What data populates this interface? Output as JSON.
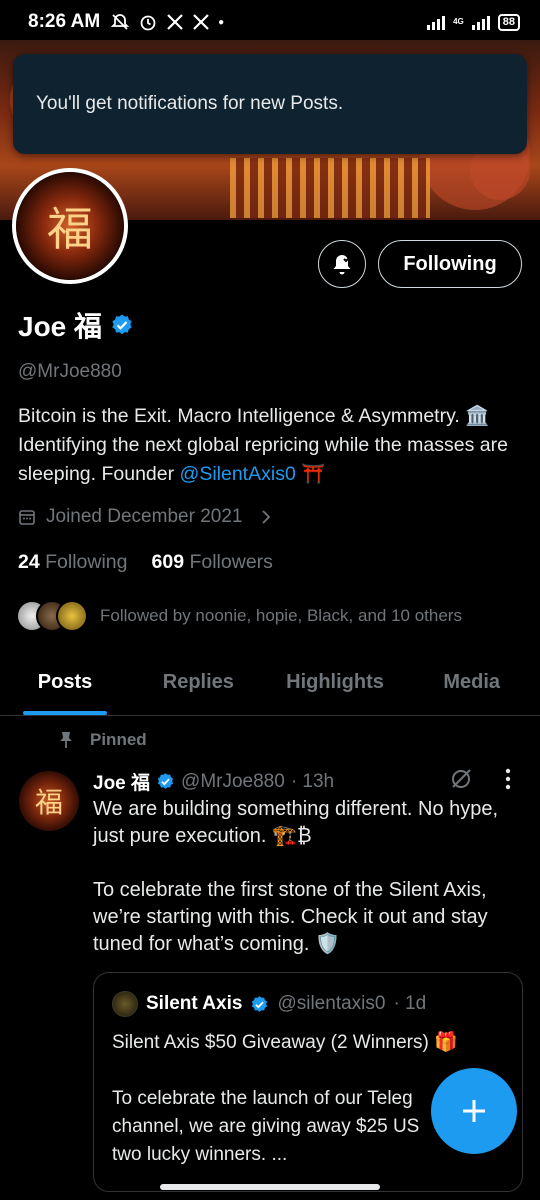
{
  "status_bar": {
    "time": "8:26 AM",
    "network": "4G",
    "battery": "88"
  },
  "toast": {
    "message": "You'll get notifications for new Posts."
  },
  "profile": {
    "avatar_glyph": "福",
    "display_name": "Joe 福",
    "handle": "@MrJoe880",
    "bio_main": "Bitcoin is the Exit. Macro Intelligence & Asymmetry. 🏛️  Identifying the next global repricing while the masses are sleeping.   Founder ",
    "bio_link": "@SilentAxis0",
    "bio_end": " ⛩️",
    "joined": "Joined December 2021",
    "following_count": "24",
    "following_label": "Following",
    "followers_count": "609",
    "followers_label": "Followers",
    "followed_by": "Followed by noonie, hopie, Black, and 10 others",
    "following_button": "Following"
  },
  "tabs": [
    {
      "label": "Posts",
      "active": true
    },
    {
      "label": "Replies",
      "active": false
    },
    {
      "label": "Highlights",
      "active": false
    },
    {
      "label": "Media",
      "active": false
    }
  ],
  "post": {
    "pinned_label": "Pinned",
    "avatar_glyph": "福",
    "name": "Joe 福",
    "handle": "@MrJoe880",
    "time": "· 13h",
    "text": "We are building something different. No hype, just pure execution. 🏗️₿\n\nTo celebrate the first stone of the Silent Axis, we’re starting with this. Check it out and stay tuned for what’s coming. 🛡️",
    "quote": {
      "name": "Silent Axis",
      "handle": "@silentaxis0",
      "time": "· 1d",
      "text": "Silent Axis $50 Giveaway (2 Winners) 🎁\n\nTo celebrate the launch of our Teleg\nchannel, we are giving away $25 US\ntwo lucky winners.  ..."
    }
  },
  "colors": {
    "accent": "#1d9bf0",
    "text_primary": "#e7e9ea",
    "text_secondary": "#71767b",
    "toast_bg": "#0f2230"
  }
}
